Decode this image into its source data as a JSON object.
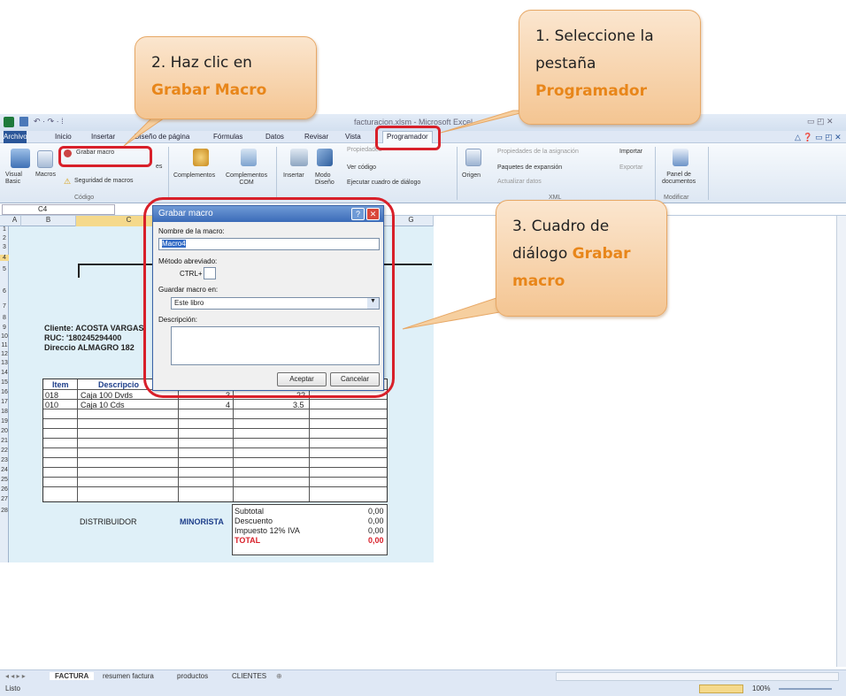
{
  "window": {
    "title": "facturacion.xlsm - Microsoft Excel"
  },
  "menu": {
    "file": "Archivo",
    "tabs": [
      "Inicio",
      "Insertar",
      "Diseño de página",
      "Fórmulas",
      "Datos",
      "Revisar",
      "Vista",
      "Programador"
    ]
  },
  "ribbon": {
    "visual_basic": "Visual\nBasic",
    "macros": "Macros",
    "grabar_macro": "Grabar macro",
    "usar_ref": "es",
    "seguridad": "Seguridad de macros",
    "codigo_group": "Código",
    "complementos": "Complementos",
    "complementos_com": "Complementos\nCOM",
    "insertar": "Insertar",
    "modo_diseno": "Modo\nDiseño",
    "propiedades": "Propiedades",
    "ver_codigo": "Ver código",
    "ejecutar": "Ejecutar cuadro de diálogo",
    "origen": "Origen",
    "prop_asignacion": "Propiedades de la asignación",
    "paquetes": "Paquetes de expansión",
    "actualizar": "Actualizar datos",
    "importar": "Importar",
    "exportar": "Exportar",
    "xml_group": "XML",
    "panel": "Panel de\ndocumentos",
    "modificar_group": "Modificar"
  },
  "formula_bar": {
    "name_box": "C4"
  },
  "columns": [
    "A",
    "B",
    "C",
    "G"
  ],
  "rows": [
    "1",
    "2",
    "3",
    "4",
    "5",
    "6",
    "7",
    "8",
    "9",
    "10",
    "11",
    "12",
    "13",
    "14",
    "15",
    "16",
    "17",
    "18",
    "19",
    "20",
    "21",
    "22",
    "23",
    "24",
    "25",
    "26",
    "27",
    "28"
  ],
  "sheet": {
    "cliente": "Cliente: ACOSTA VARGAS",
    "ruc": "RUC:   '180245294400",
    "direccion": "Direccio ALMAGRO 182",
    "item_h": "Item",
    "desc_h": "Descripcio",
    "rows": [
      {
        "item": "018",
        "desc": "Caja 100 Dvds",
        "qty": "3",
        "price": "22"
      },
      {
        "item": "010",
        "desc": "Caja 10 Cds",
        "qty": "4",
        "price": "3.5"
      }
    ],
    "distribuidor": "DISTRIBUIDOR",
    "minorista": "MINORISTA",
    "subtotal": "Subtotal",
    "descuento": "Descuento",
    "impuesto": "Impuesto 12% IVA",
    "total": "TOTAL",
    "subtotal_v": "0,00",
    "descuento_v": "0,00",
    "impuesto_v": "0,00",
    "total_v": "0,00"
  },
  "dialog": {
    "title": "Grabar macro",
    "nombre_label": "Nombre de la macro:",
    "nombre_value": "Macro4",
    "metodo_label": "Método abreviado:",
    "ctrl": "CTRL+",
    "guardar_label": "Guardar macro en:",
    "guardar_value": "Este libro",
    "desc_label": "Descripción:",
    "aceptar": "Aceptar",
    "cancelar": "Cancelar"
  },
  "callouts": {
    "c1_line1": "1. Seleccione la",
    "c1_line2": "pestaña",
    "c1_line3": "Programador",
    "c2_line1": "2. Haz clic en",
    "c2_line2": "Grabar Macro",
    "c3_line1": "3. Cuadro de",
    "c3_line2a": "diálogo ",
    "c3_line2b": "Grabar",
    "c3_line3": "macro"
  },
  "sheet_tabs": [
    "FACTURA",
    "resumen factura",
    "productos",
    "CLIENTES"
  ],
  "status": {
    "ready": "Listo",
    "zoom": "100%"
  },
  "colors": {
    "accent_red": "#d8202a",
    "callout_orange": "#e8861a",
    "file_tab": "#2a5699"
  }
}
